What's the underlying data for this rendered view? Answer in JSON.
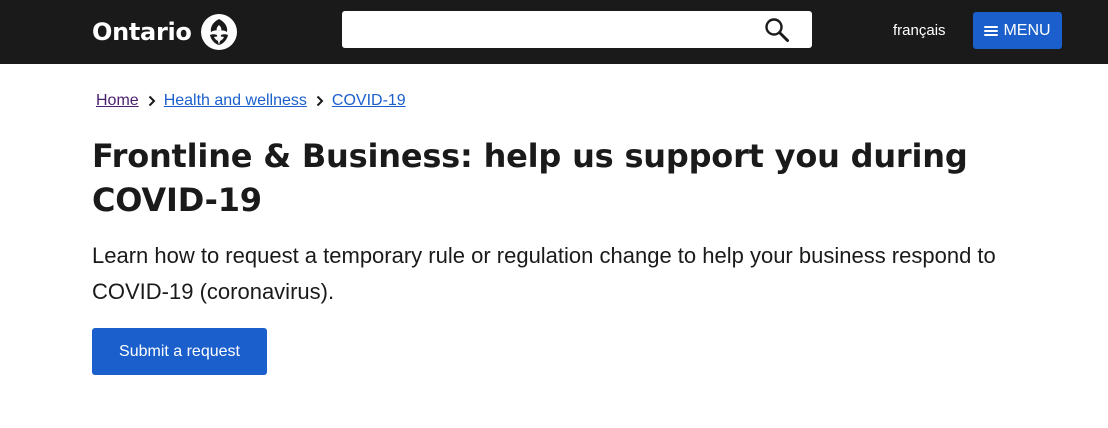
{
  "header": {
    "logo_text": "Ontario",
    "logo_icon": "trillium-icon",
    "search": {
      "value": "",
      "placeholder": "",
      "button_icon": "search-icon"
    },
    "language_link": "français",
    "menu_label": "MENU",
    "menu_icon": "hamburger-icon"
  },
  "breadcrumb": {
    "items": [
      {
        "label": "Home",
        "state": "visited"
      },
      {
        "label": "Health and wellness",
        "state": "link"
      },
      {
        "label": "COVID-19",
        "state": "link"
      }
    ]
  },
  "main": {
    "title": "Frontline & Business: help us support you during COVID-19",
    "lead": "Learn how to request a temporary rule or regulation change to help your business respond to COVID-19 (coronavirus).",
    "submit_label": "Submit a request"
  },
  "colors": {
    "header_bg": "#1a1a1a",
    "accent_blue": "#1a5fcc",
    "visited_link": "#4a1f6e",
    "text": "#1a1a1a"
  }
}
